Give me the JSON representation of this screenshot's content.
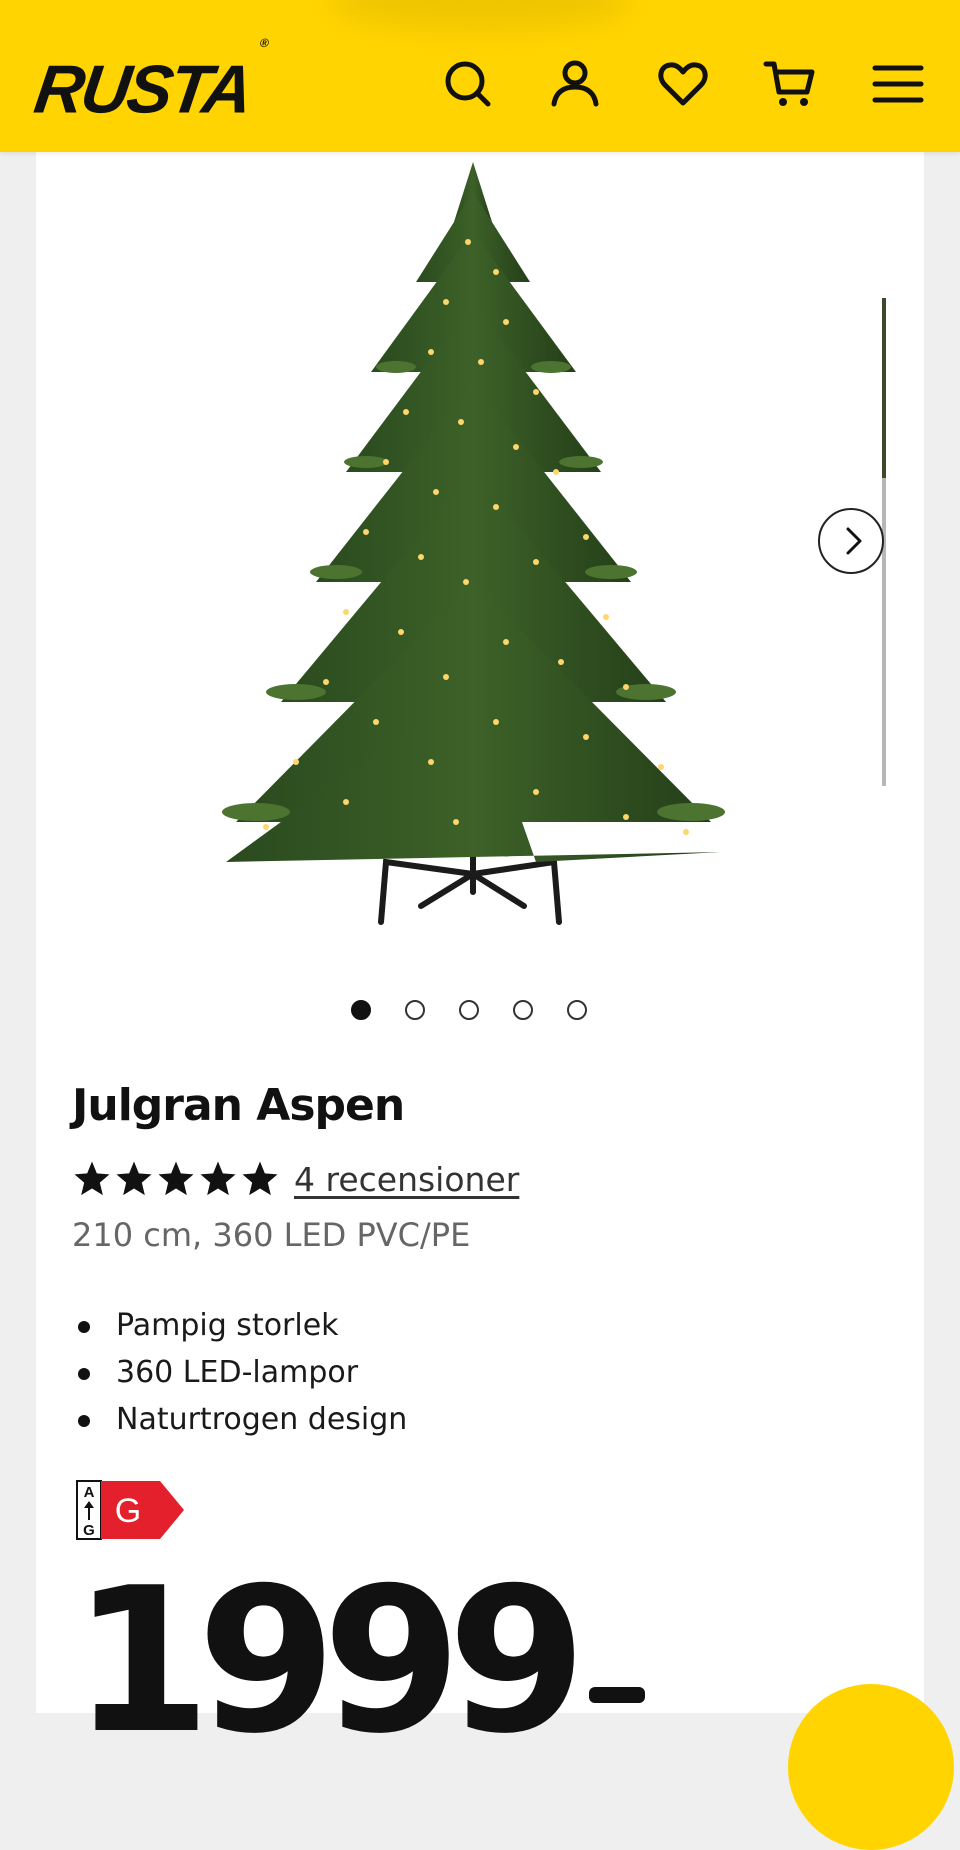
{
  "header": {
    "logo_text": "RUSTA",
    "logo_mark": "®",
    "brand_color": "#ffd400",
    "icons": [
      "search-icon",
      "account-icon",
      "heart-icon",
      "cart-icon",
      "menu-icon"
    ]
  },
  "gallery": {
    "image_count": 5,
    "active_index": 0,
    "next_icon": "chevron-right-icon"
  },
  "product": {
    "title": "Julgran Aspen",
    "rating": 5,
    "rating_max": 5,
    "reviews_label": "4 recensioner",
    "variant": "210 cm, 360 LED PVC/PE",
    "features": [
      "Pampig storlek",
      "360 LED-lampor",
      "Naturtrogen design"
    ],
    "energy_class": {
      "scale_top": "A",
      "scale_bottom": "G",
      "class": "G",
      "color": "#e3202b"
    },
    "price": "1999"
  }
}
